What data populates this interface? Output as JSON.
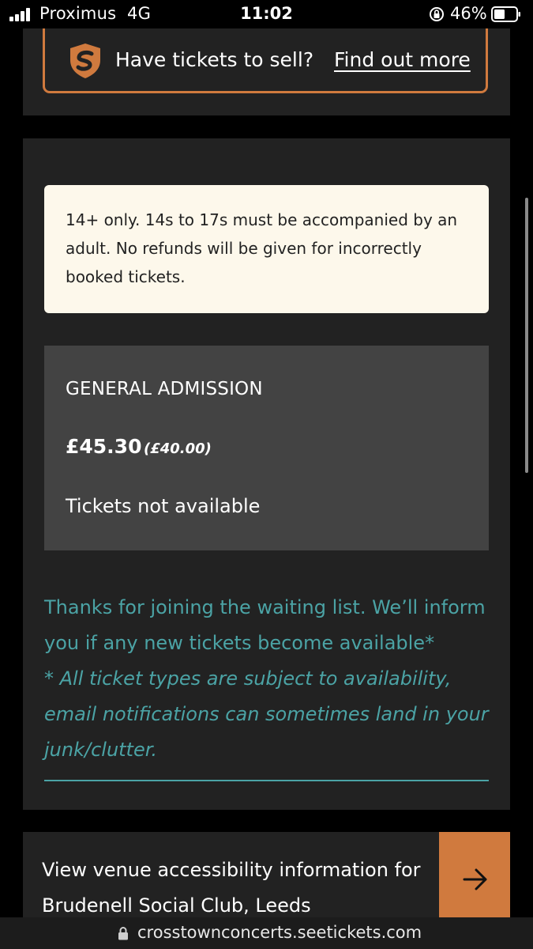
{
  "status_bar": {
    "carrier": "Proximus",
    "network": "4G",
    "time": "11:02",
    "battery": "46%"
  },
  "banner": {
    "text": "Have tickets to sell?",
    "link": "Find out more",
    "accent_color": "#d07a3e"
  },
  "notice": {
    "text": "14+ only. 14s to 17s must be accompanied by an adult. No refunds will be given for incorrectly booked tickets."
  },
  "ticket": {
    "type": "GENERAL ADMISSION",
    "price": "£45.30",
    "face_value": "(£40.00)",
    "status": "Tickets not available"
  },
  "waiting_list": {
    "message": "Thanks for joining the waiting list. We’ll inform you if any new tickets become available*",
    "note": "* All ticket types are subject to availability, email notifications can sometimes land in your junk/clutter.",
    "color": "#4ba3a5"
  },
  "accessibility": {
    "text": "View venue accessibility information for Brudenell Social Club, Leeds"
  },
  "browser": {
    "url": "crosstownconcerts.seetickets.com"
  }
}
